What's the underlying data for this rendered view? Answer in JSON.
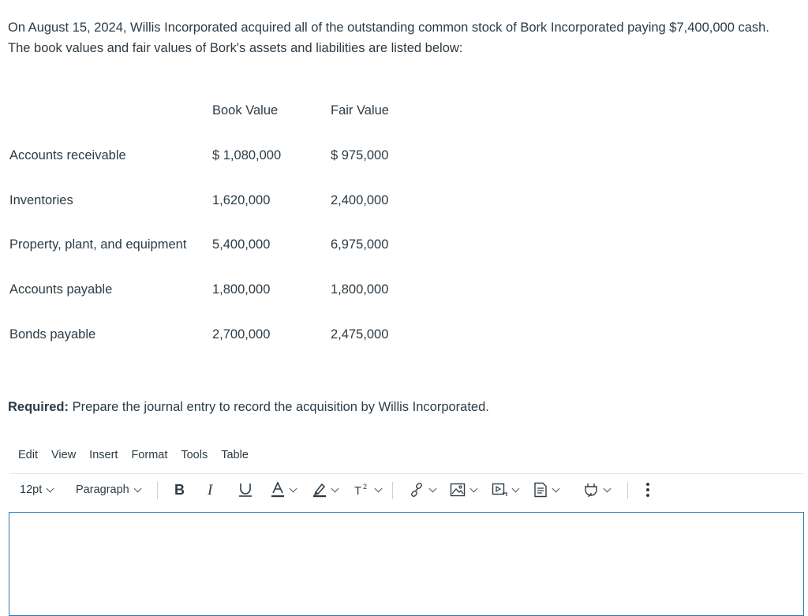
{
  "question": {
    "text": "On August 15, 2024, Willis Incorporated acquired all of the outstanding common stock of Bork Incorporated paying $7,400,000 cash. The book values and fair values of Bork's assets and liabilities are listed below:"
  },
  "table": {
    "headers": {
      "book": "Book Value",
      "fair": "Fair Value"
    },
    "rows": [
      {
        "label": "Accounts receivable",
        "book": "$ 1,080,000",
        "fair": "$ 975,000"
      },
      {
        "label": "Inventories",
        "book": "1,620,000",
        "fair": "2,400,000"
      },
      {
        "label": "Property, plant, and equipment",
        "book": "5,400,000",
        "fair": "6,975,000"
      },
      {
        "label": "Accounts payable",
        "book": "1,800,000",
        "fair": "1,800,000"
      },
      {
        "label": "Bonds payable",
        "book": "2,700,000",
        "fair": "2,475,000"
      }
    ]
  },
  "required": {
    "label": "Required:",
    "text": " Prepare the journal entry to record the acquisition by Willis Incorporated."
  },
  "editor": {
    "menu": [
      "Edit",
      "View",
      "Insert",
      "Format",
      "Tools",
      "Table"
    ],
    "font_size": "12pt",
    "block_format": "Paragraph",
    "icons": [
      "bold-icon",
      "italic-icon",
      "underline-icon",
      "text-color-icon",
      "highlight-icon",
      "superscript-icon",
      "link-icon",
      "image-icon",
      "media-icon",
      "document-icon",
      "apps-icon",
      "more-icon"
    ],
    "accent_color": "#2b7abc"
  }
}
